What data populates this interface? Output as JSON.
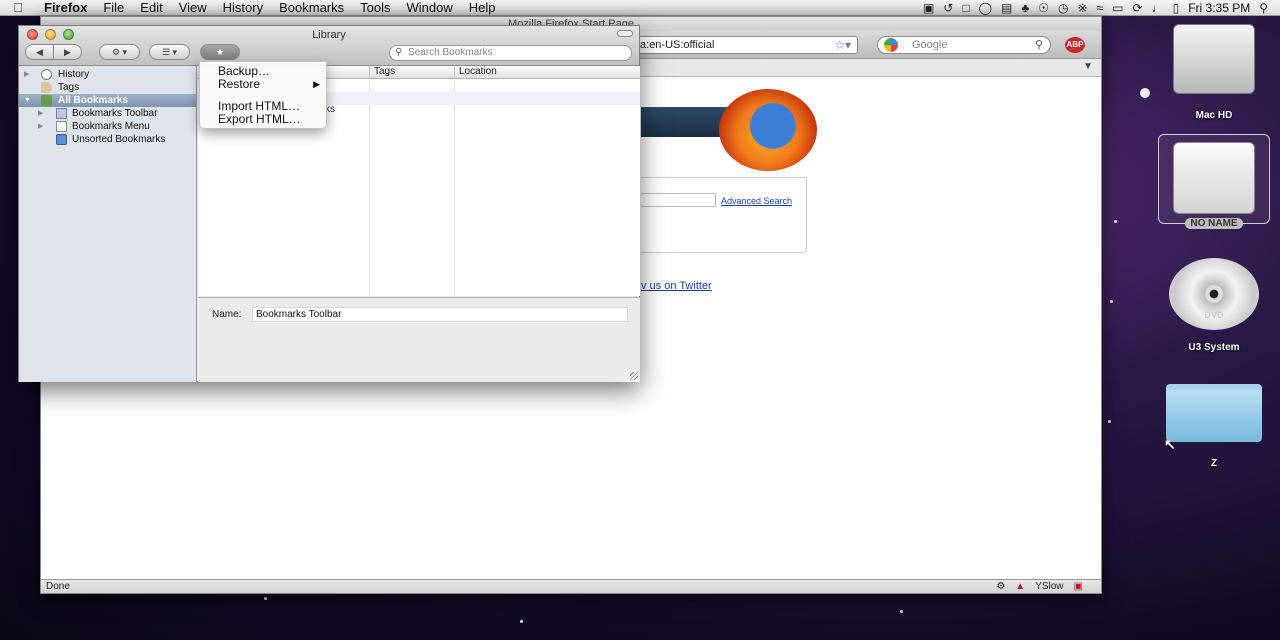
{
  "menubar": {
    "app": "Firefox",
    "items": [
      "File",
      "Edit",
      "View",
      "History",
      "Bookmarks",
      "Tools",
      "Window",
      "Help"
    ],
    "clock": "Fri 3:35 PM"
  },
  "firefox": {
    "window_title": "Mozilla Firefox Start Page",
    "url": "a:en-US:official",
    "search_engine_placeholder": "Google",
    "adblock_label": "ABP",
    "advanced_search": "Advanced Search",
    "twitter_link": "v us on Twitter",
    "status_text": "Done",
    "yslow_label": "YSlow"
  },
  "library": {
    "title": "Library",
    "search_placeholder": "Search Bookmarks",
    "sidebar": [
      {
        "label": "History"
      },
      {
        "label": "Tags"
      },
      {
        "label": "All Bookmarks"
      },
      {
        "label": "Bookmarks Toolbar"
      },
      {
        "label": "Bookmarks Menu"
      },
      {
        "label": "Unsorted Bookmarks"
      }
    ],
    "columns": {
      "tags": "Tags",
      "location": "Location"
    },
    "rows": [
      {
        "partial_name": "ks"
      }
    ],
    "details": {
      "name_label": "Name:",
      "name_value": "Bookmarks Toolbar"
    }
  },
  "import_menu": {
    "items": [
      "Backup…",
      "Restore",
      "Import HTML…",
      "Export HTML…"
    ]
  },
  "desktop": {
    "icons": [
      {
        "label": "Mac HD"
      },
      {
        "label": "NO NAME"
      },
      {
        "label": "U3 System"
      },
      {
        "label": "Z"
      }
    ],
    "dvd_text": "DVD"
  }
}
